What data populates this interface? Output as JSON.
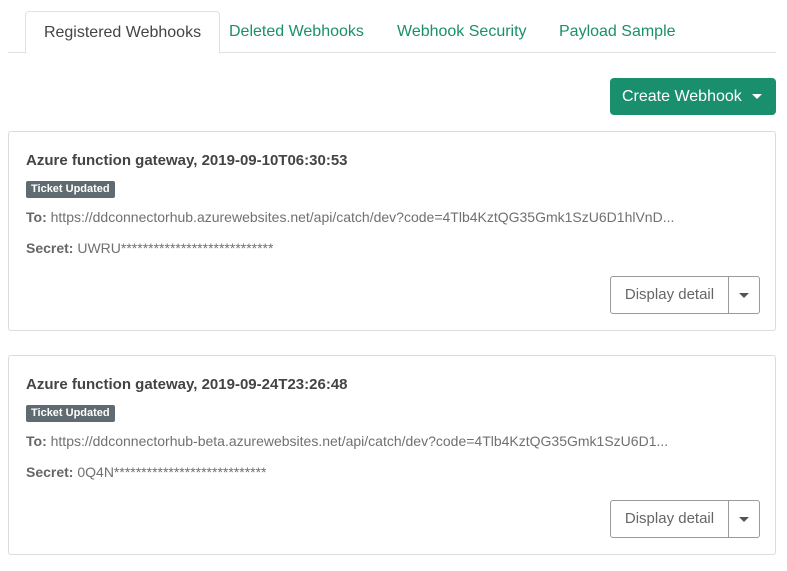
{
  "tabs": [
    {
      "label": "Registered Webhooks",
      "active": true
    },
    {
      "label": "Deleted Webhooks",
      "active": false
    },
    {
      "label": "Webhook Security",
      "active": false
    },
    {
      "label": "Payload Sample",
      "active": false
    }
  ],
  "toolbar": {
    "create_label": "Create Webhook",
    "create_icon": "caret-down-icon"
  },
  "webhooks": [
    {
      "title": "Azure function gateway, 2019-09-10T06:30:53",
      "event": "Ticket Updated",
      "to_label": "To:",
      "to_value": "https://ddconnectorhub.azurewebsites.net/api/catch/dev?code=4Tlb4KztQG35Gmk1SzU6D1hlVnD...",
      "secret_label": "Secret:",
      "secret_value": "UWRU****************************",
      "detail_label": "Display detail"
    },
    {
      "title": "Azure function gateway, 2019-09-24T23:26:48",
      "event": "Ticket Updated",
      "to_label": "To:",
      "to_value": "https://ddconnectorhub-beta.azurewebsites.net/api/catch/dev?code=4Tlb4KztQG35Gmk1SzU6D1...",
      "secret_label": "Secret:",
      "secret_value": "0Q4N****************************",
      "detail_label": "Display detail"
    }
  ],
  "colors": {
    "accent": "#1a8f6d",
    "badge": "#5f6b70",
    "border": "#dcdcdc"
  }
}
